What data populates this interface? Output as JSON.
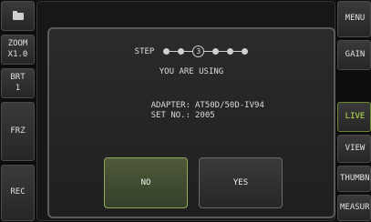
{
  "left_panel": {
    "folder_icon": "folder-icon",
    "zoom_label": "ZOOM\nX1.0",
    "brt_label": "BRT\n1",
    "frz_label": "FRZ",
    "rec_label": "REC"
  },
  "right_panel": {
    "menu_label": "MENU",
    "gain_label": "GAIN",
    "live_label": "LIVE",
    "view_label": "VIEW",
    "thumbnail_label": "THUMBNAIL",
    "measure_label": "MEASURE",
    "live_color": "#b9e34a"
  },
  "dialog": {
    "step_label": "STEP",
    "current_step": "3",
    "using_text": "YOU ARE USING",
    "adapter_label": "ADAPTER:",
    "adapter_value": "AT50D/50D-IV94",
    "setno_label": "SET NO.:",
    "setno_value": "2005",
    "no_label": "NO",
    "yes_label": "YES"
  }
}
